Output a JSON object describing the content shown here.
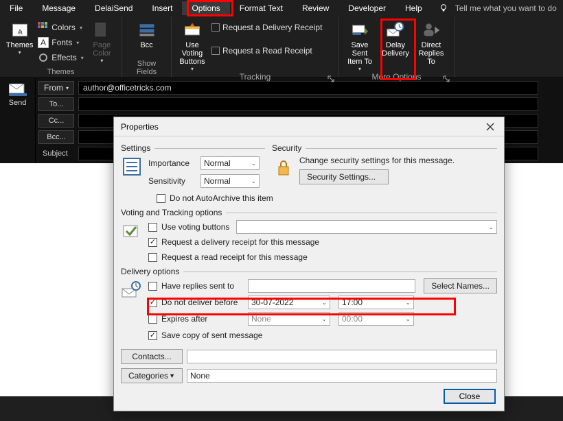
{
  "tabs": {
    "file": "File",
    "message": "Message",
    "delaysend": "DelaiSend",
    "insert": "Insert",
    "options": "Options",
    "formattext": "Format Text",
    "review": "Review",
    "developer": "Developer",
    "help": "Help",
    "tellme": "Tell me what you want to do"
  },
  "ribbon": {
    "themes": {
      "button": "Themes",
      "colors": "Colors",
      "fonts": "Fonts",
      "effects": "Effects",
      "pagecolor": "Page\nColor",
      "group_label": "Themes"
    },
    "showfields": {
      "bcc": "Bcc",
      "group_label": "Show Fields"
    },
    "tracking": {
      "voting": "Use Voting\nButtons",
      "delivery_receipt": "Request a Delivery Receipt",
      "read_receipt": "Request a Read Receipt",
      "group_label": "Tracking"
    },
    "more": {
      "save_sent": "Save Sent\nItem To",
      "delay": "Delay\nDelivery",
      "direct": "Direct\nReplies To",
      "group_label": "More Options"
    }
  },
  "compose": {
    "send": "Send",
    "from": "From",
    "to": "To...",
    "cc": "Cc...",
    "bcc": "Bcc...",
    "subject": "Subject",
    "from_value": "author@officetricks.com"
  },
  "dialog": {
    "title": "Properties",
    "settings": {
      "label": "Settings",
      "importance": "Importance",
      "importance_val": "Normal",
      "sensitivity": "Sensitivity",
      "sensitivity_val": "Normal",
      "autoarchive": "Do not AutoArchive this item"
    },
    "security": {
      "label": "Security",
      "desc": "Change security settings for this message.",
      "button": "Security Settings..."
    },
    "voting": {
      "label": "Voting and Tracking options",
      "use_voting": "Use voting buttons",
      "req_delivery": "Request a delivery receipt for this message",
      "req_read": "Request a read receipt for this message"
    },
    "delivery": {
      "label": "Delivery options",
      "have_replies": "Have replies sent to",
      "select_names": "Select Names...",
      "do_not_deliver": "Do not deliver before",
      "date": "30-07-2022",
      "time": "17:00",
      "expires": "Expires after",
      "exp_date": "None",
      "exp_time": "00:00",
      "save_copy": "Save copy of sent message"
    },
    "contacts": "Contacts...",
    "categories": "Categories",
    "categories_val": "None",
    "close": "Close"
  }
}
